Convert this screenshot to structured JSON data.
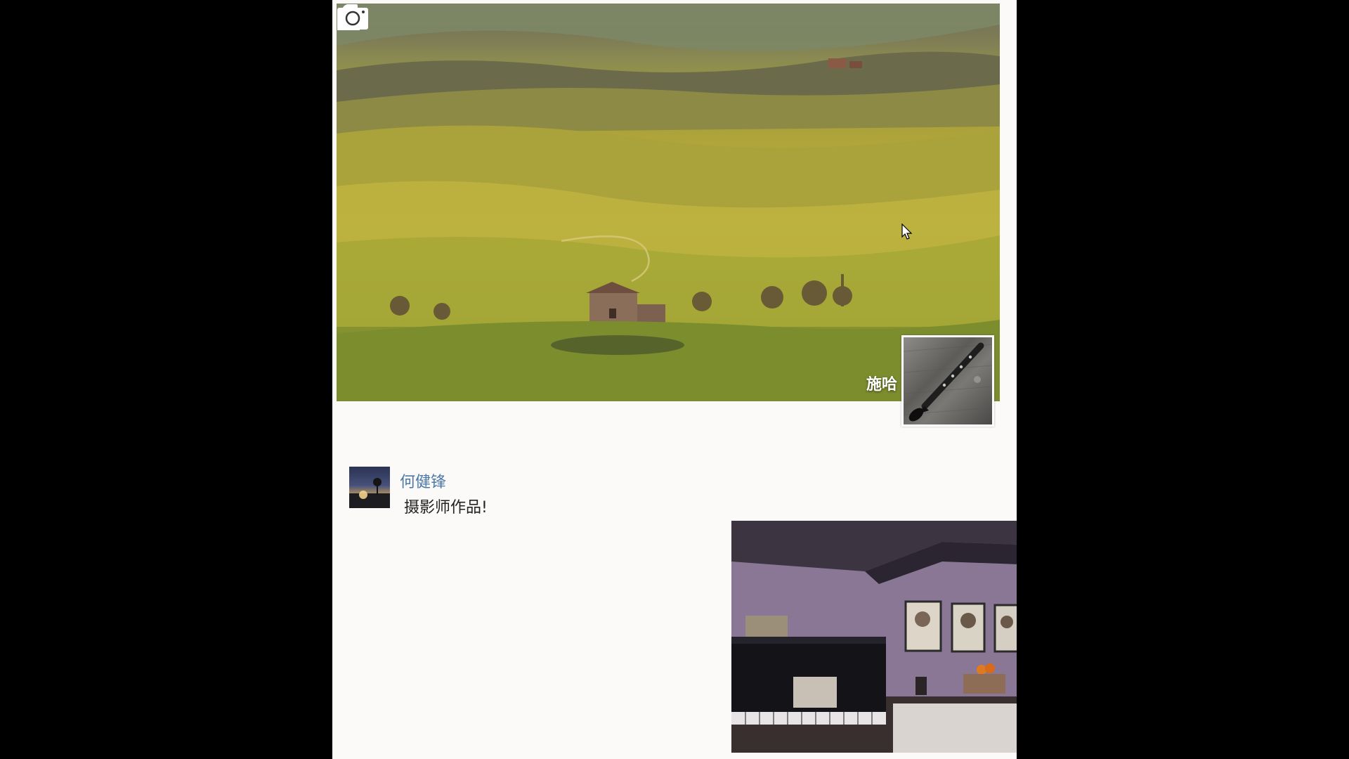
{
  "header": {
    "user_icon": "user-icon",
    "camera_icon": "camera-icon",
    "profile_name": "施哈"
  },
  "post": {
    "author": "何健锋",
    "text": "摄影师作品!",
    "photos": [
      {
        "subject": "piano-room-photo"
      },
      {
        "subject": "saxophone-photo"
      }
    ]
  },
  "colors": {
    "author_link": "#4b7aa8",
    "page_background": "#fbfaf9"
  }
}
